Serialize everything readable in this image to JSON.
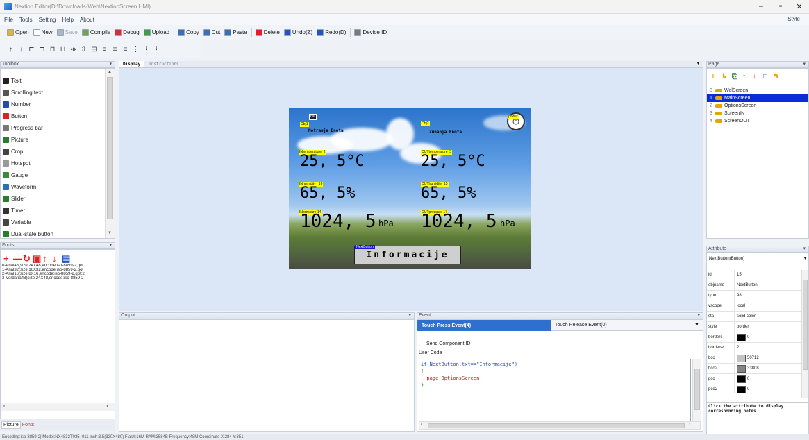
{
  "window": {
    "title": "Nextion Editor(D:\\Downloads-Web\\NextionScreen.HMI)",
    "min": "–",
    "max": "▫",
    "close": "✕"
  },
  "menu": {
    "items": [
      "File",
      "Tools",
      "Setting",
      "Help",
      "About"
    ],
    "style": "Style"
  },
  "toolbar": {
    "items": [
      {
        "label": "Open",
        "icon": "open-folder-icon",
        "color": "#e2b13c",
        "enabled": true
      },
      {
        "label": "New",
        "icon": "new-file-icon",
        "color": "#ffffff",
        "enabled": true
      },
      {
        "label": "Save",
        "icon": "save-icon",
        "color": "#a9b6c9",
        "enabled": false
      },
      {
        "label": "Compile",
        "icon": "compile-icon",
        "color": "#6aa84f",
        "enabled": true
      },
      {
        "label": "Debug",
        "icon": "debug-icon",
        "color": "#cc3333",
        "enabled": true
      },
      {
        "label": "Upload",
        "icon": "upload-icon",
        "color": "#3f9e3f",
        "enabled": true
      },
      {
        "label": "Copy",
        "icon": "copy-icon",
        "color": "#3a6fb5",
        "enabled": true
      },
      {
        "label": "Cut",
        "icon": "cut-icon",
        "color": "#3a6fb5",
        "enabled": true
      },
      {
        "label": "Paste",
        "icon": "paste-icon",
        "color": "#3a6fb5",
        "enabled": true
      },
      {
        "label": "Delete",
        "icon": "delete-icon",
        "color": "#d22",
        "enabled": true
      },
      {
        "label": "Undo(Z)",
        "icon": "undo-icon",
        "color": "#1f55c8",
        "enabled": true
      },
      {
        "label": "Redo(D)",
        "icon": "redo-icon",
        "color": "#1f55c8",
        "enabled": true
      },
      {
        "label": "Device ID",
        "icon": "device-id-icon",
        "color": "#7a7a7a",
        "enabled": true
      }
    ],
    "align_icons": [
      "↑",
      "↓",
      "⊏",
      "⊐",
      "⊓",
      "⊔",
      "⇹",
      "⇳",
      "⊞",
      "≡",
      "≡",
      "≡",
      "⋮",
      "⁞",
      "⁞"
    ]
  },
  "toolbox": {
    "title": "Toolbox",
    "items": [
      {
        "label": "Text",
        "icon": "text-icon",
        "color": "#222"
      },
      {
        "label": "Scrolling text",
        "icon": "scrolling-text-icon",
        "color": "#555"
      },
      {
        "label": "Number",
        "icon": "number-icon",
        "color": "#1f4fa8"
      },
      {
        "label": "Button",
        "icon": "button-icon",
        "color": "#d22"
      },
      {
        "label": "Progress bar",
        "icon": "progress-bar-icon",
        "color": "#777"
      },
      {
        "label": "Picture",
        "icon": "picture-icon",
        "color": "#2a7b2a"
      },
      {
        "label": "Crop",
        "icon": "crop-icon",
        "color": "#444"
      },
      {
        "label": "Hotspot",
        "icon": "hotspot-icon",
        "color": "#999"
      },
      {
        "label": "Gauge",
        "icon": "gauge-icon",
        "color": "#3a8a3a"
      },
      {
        "label": "Waveform",
        "icon": "waveform-icon",
        "color": "#2a6fb5"
      },
      {
        "label": "Slider",
        "icon": "slider-icon",
        "color": "#2a7b2a"
      },
      {
        "label": "Timer",
        "icon": "timer-icon",
        "color": "#333"
      },
      {
        "label": "Variable",
        "icon": "variable-icon",
        "color": "#444"
      },
      {
        "label": "Dual-state button",
        "icon": "dual-state-button-icon",
        "color": "#2a7b2a"
      }
    ]
  },
  "fonts": {
    "title": "Fonts",
    "icons": [
      "+",
      "—",
      "↻",
      "▣",
      "↑",
      "↓",
      "▤"
    ],
    "list": [
      "0-Arial48(size:24X48,encode:iso-8859-2,qot",
      "1-Arial32(size:16X32,encode:iso-8859-2,qot",
      "2-Arial16(size:8X16,encode:iso-8859-2,qot:2",
      "3-Verdana48(size:24X48,encode:iso-8859-2"
    ],
    "bottom_tabs": [
      "Picture",
      "Fonts"
    ]
  },
  "editor_tabs": [
    "Display",
    "Instructions"
  ],
  "screen": {
    "labels": {
      "obj1": "Obj1",
      "bat": "bat",
      "obj2": "Obj2",
      "power": "power",
      "in_temp": "INtemperature",
      "in_temp_id": "2",
      "out_temp": "OUTtemperature",
      "out_temp_id": "3",
      "in_hum": "INhumidity",
      "in_hum_id": "16",
      "out_hum": "OUThumidity",
      "out_hum_id": "15",
      "in_press": "INpressure",
      "in_press_id": "14",
      "out_press": "OUTpressure",
      "out_press_id": "17",
      "next_button": "NextButton"
    },
    "unit_in": "Notranja Enota",
    "unit_out": "Zunanja Enota",
    "temp_in": "25, 5°C",
    "temp_out": "25, 5°C",
    "hum_in": "65, 5%",
    "hum_out": "65, 5%",
    "press_in": "1024, 5",
    "press_out": "1024, 5",
    "press_unit": "hPa",
    "info_button": "Informacije"
  },
  "page_panel": {
    "title": "Page",
    "icons": [
      "+",
      "↳",
      "⎘",
      "↑",
      "↓",
      "□",
      "✎"
    ],
    "items": [
      "WelScreen",
      "MainScreen",
      "OptionsScreen",
      "ScreenIN",
      "ScreenOUT"
    ],
    "indices": [
      "0",
      "1",
      "2",
      "3",
      "4"
    ],
    "selected_index": 1
  },
  "attribute_panel": {
    "title": "Attribute",
    "selector": "NextButton(Button)",
    "rows": [
      {
        "k": "id",
        "v": "15"
      },
      {
        "k": "objname",
        "v": "NextButton"
      },
      {
        "k": "type",
        "v": "98"
      },
      {
        "k": "vscope",
        "v": "local"
      },
      {
        "k": "sta",
        "v": "solid color"
      },
      {
        "k": "style",
        "v": "border"
      },
      {
        "k": "borderc",
        "v": "0",
        "swatch": "#000000"
      },
      {
        "k": "borderw",
        "v": "2"
      },
      {
        "k": "bco",
        "v": "50712",
        "swatch": "#c3c3c3"
      },
      {
        "k": "bco2",
        "v": "33808",
        "swatch": "#848484"
      },
      {
        "k": "pco",
        "v": "0",
        "swatch": "#000000"
      },
      {
        "k": "pco2",
        "v": "0",
        "swatch": "#000000"
      }
    ],
    "note": "Click the attribute to display corresponding notes"
  },
  "output_panel": {
    "title": "Output"
  },
  "event_panel": {
    "title": "Event",
    "tab_press": "Touch Press Event(4)",
    "tab_release": "Touch Release Event(0)",
    "send_id_label": "Send Component ID",
    "user_code_label": "User Code",
    "code_line1": "if(NextButton.txt==\"Informacije\")",
    "code_line2": "{",
    "code_line3": "  page OptionsScreen",
    "code_line4": "}"
  },
  "statusbar": "Encoding:iso-8859-2| Model:NX4832T035_011  inch:3.5(320X480) Flash:16M RAM:3584B Frequency:48M    Coordinate X:284  Y:351"
}
